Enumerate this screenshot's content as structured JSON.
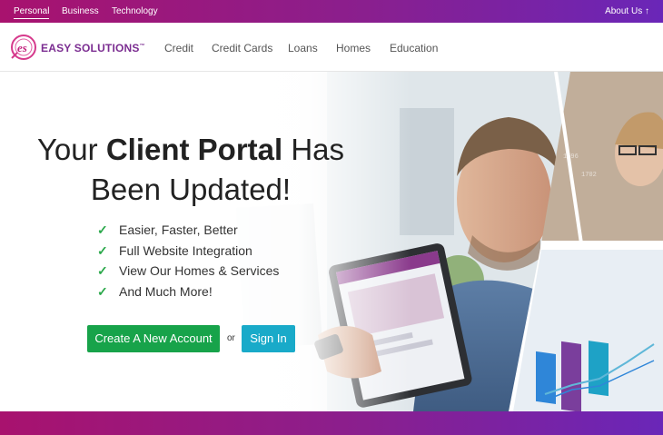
{
  "topbar": {
    "tabs": [
      "Personal",
      "Business",
      "Technology"
    ],
    "about": "About Us ↑"
  },
  "brand": {
    "logo_text": "EASY SOLUTIONS",
    "trademark": "™"
  },
  "nav": {
    "items": [
      "Credit",
      "Credit Cards",
      "Loans",
      "Homes",
      "Education"
    ]
  },
  "hero": {
    "headline_pre": "Your ",
    "headline_bold": "Client Portal",
    "headline_post": " Has",
    "headline_line2": "Been Updated!",
    "features": [
      "Easier, Faster, Better",
      "Full Website Integration",
      "View Our Homes & Services",
      "And Much More!"
    ],
    "check_glyph": "✓",
    "create_button": "Create A New Account",
    "or_text": "or",
    "signin_button": "Sign In"
  },
  "colors": {
    "brand_gradient_start": "#a8126e",
    "brand_gradient_end": "#6a26b8",
    "create_button": "#17a34a",
    "signin_button": "#19aac9",
    "check": "#2aa84a"
  }
}
